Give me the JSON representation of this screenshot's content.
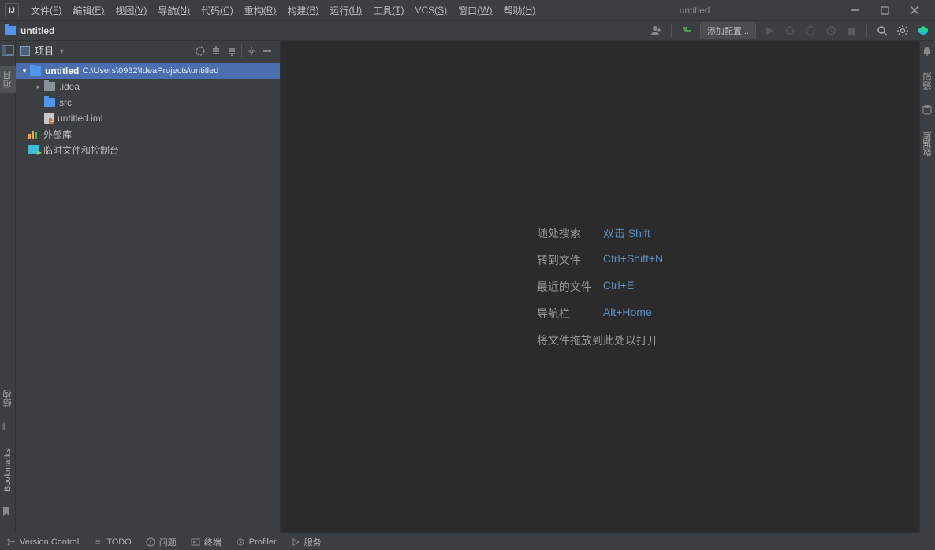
{
  "app": {
    "title": "untitled"
  },
  "menu": [
    {
      "label": "文件",
      "key": "(F)"
    },
    {
      "label": "编辑",
      "key": "(E)"
    },
    {
      "label": "视图",
      "key": "(V)"
    },
    {
      "label": "导航",
      "key": "(N)"
    },
    {
      "label": "代码",
      "key": "(C)"
    },
    {
      "label": "重构",
      "key": "(R)"
    },
    {
      "label": "构建",
      "key": "(B)"
    },
    {
      "label": "运行",
      "key": "(U)"
    },
    {
      "label": "工具",
      "key": "(T)"
    },
    {
      "label": "VCS",
      "key": "(S)"
    },
    {
      "label": "窗口",
      "key": "(W)"
    },
    {
      "label": "帮助",
      "key": "(H)"
    }
  ],
  "nav": {
    "crumb": "untitled",
    "runconfig": "添加配置..."
  },
  "projectPanel": {
    "title": "项目"
  },
  "tree": {
    "root": {
      "name": "untitled",
      "path": "C:\\Users\\0932\\IdeaProjects\\untitled"
    },
    "idea": ".idea",
    "src": "src",
    "iml": "untitled.iml",
    "ext": "外部库",
    "scratch": "临时文件和控制台"
  },
  "tips": [
    {
      "label": "随处搜索",
      "kb": "双击 Shift"
    },
    {
      "label": "转到文件",
      "kb": "Ctrl+Shift+N"
    },
    {
      "label": "最近的文件",
      "kb": "Ctrl+E"
    },
    {
      "label": "导航栏",
      "kb": "Alt+Home"
    }
  ],
  "tipsExtra": "将文件拖放到此处以打开",
  "leftGutter": {
    "proj": "项目",
    "struct": "结构",
    "bm": "Bookmarks"
  },
  "rightGutter": {
    "notif": "通知",
    "db": "数据库"
  },
  "status": {
    "vc": "Version Control",
    "todo": "TODO",
    "problems": "问题",
    "terminal": "终端",
    "profiler": "Profiler",
    "services": "服务"
  }
}
